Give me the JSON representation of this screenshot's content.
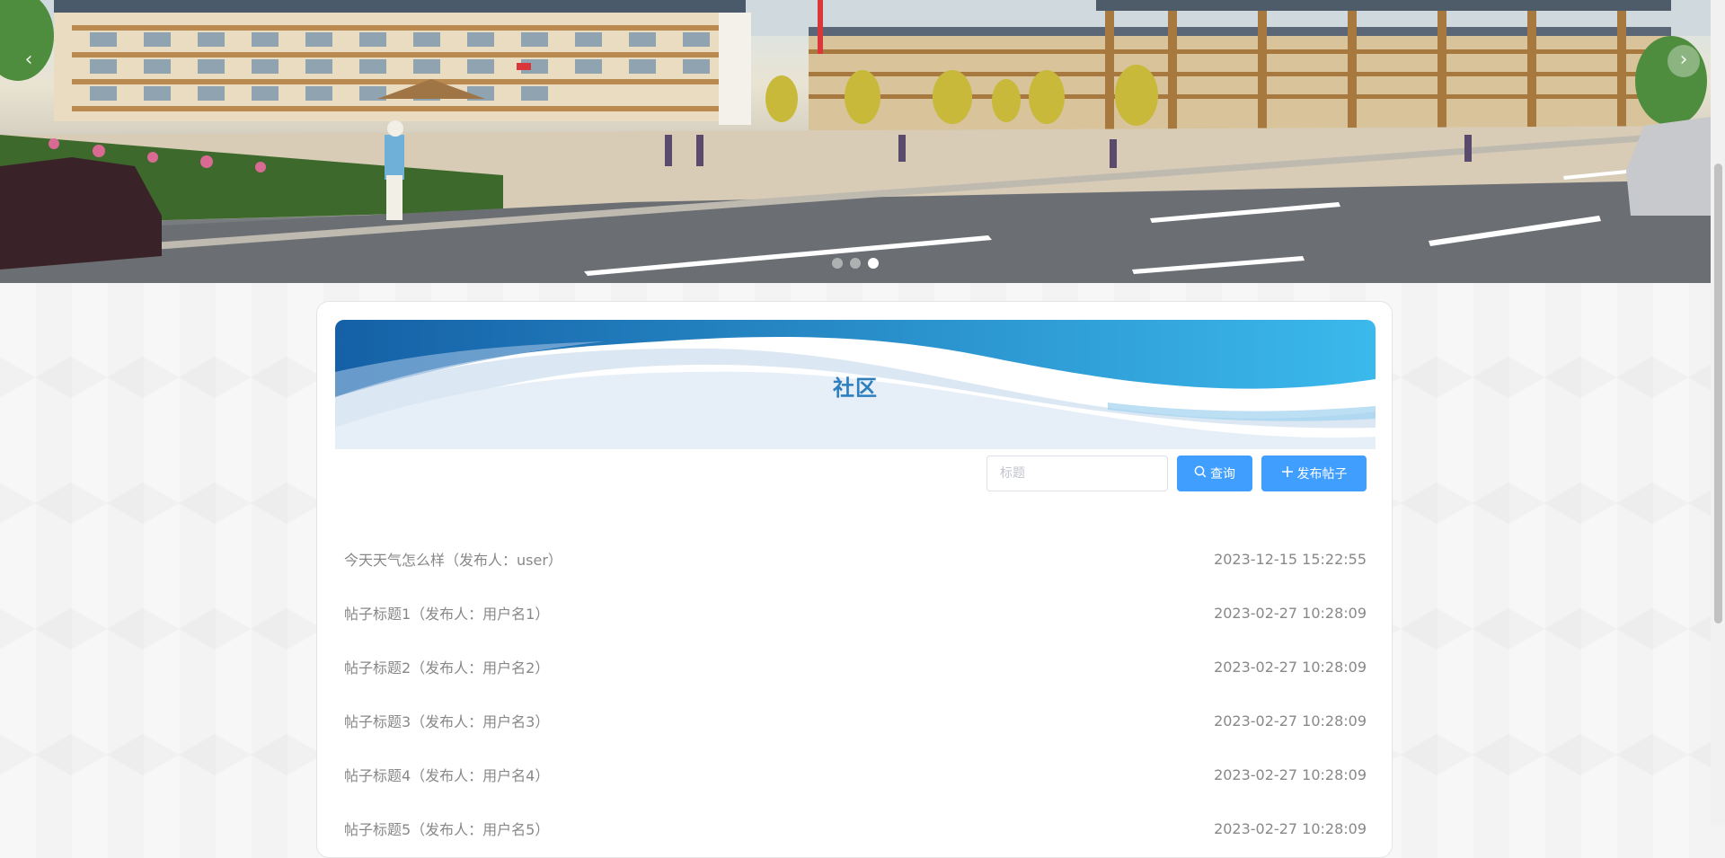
{
  "carousel": {
    "prev_arrow": "‹",
    "next_arrow": "›",
    "slides": 3,
    "active_slide_index": 2
  },
  "community": {
    "title": "社区",
    "search_placeholder": "标题",
    "query_button": "查询",
    "publish_button": "发布帖子"
  },
  "posts": [
    {
      "title": "今天天气怎么样（发布人：user）",
      "time": "2023-12-15 15:22:55"
    },
    {
      "title": "帖子标题1（发布人：用户名1）",
      "time": "2023-02-27 10:28:09"
    },
    {
      "title": "帖子标题2（发布人：用户名2）",
      "time": "2023-02-27 10:28:09"
    },
    {
      "title": "帖子标题3（发布人：用户名3）",
      "time": "2023-02-27 10:28:09"
    },
    {
      "title": "帖子标题4（发布人：用户名4）",
      "time": "2023-02-27 10:28:09"
    },
    {
      "title": "帖子标题5（发布人：用户名5）",
      "time": "2023-02-27 10:28:09"
    }
  ],
  "icons": {
    "search": "search-icon",
    "plus": "plus-icon"
  },
  "colors": {
    "accent": "#409eff",
    "title": "#2f7fbf",
    "wave_dark": "#1e6fb3",
    "wave_light": "#3bb9ec"
  }
}
